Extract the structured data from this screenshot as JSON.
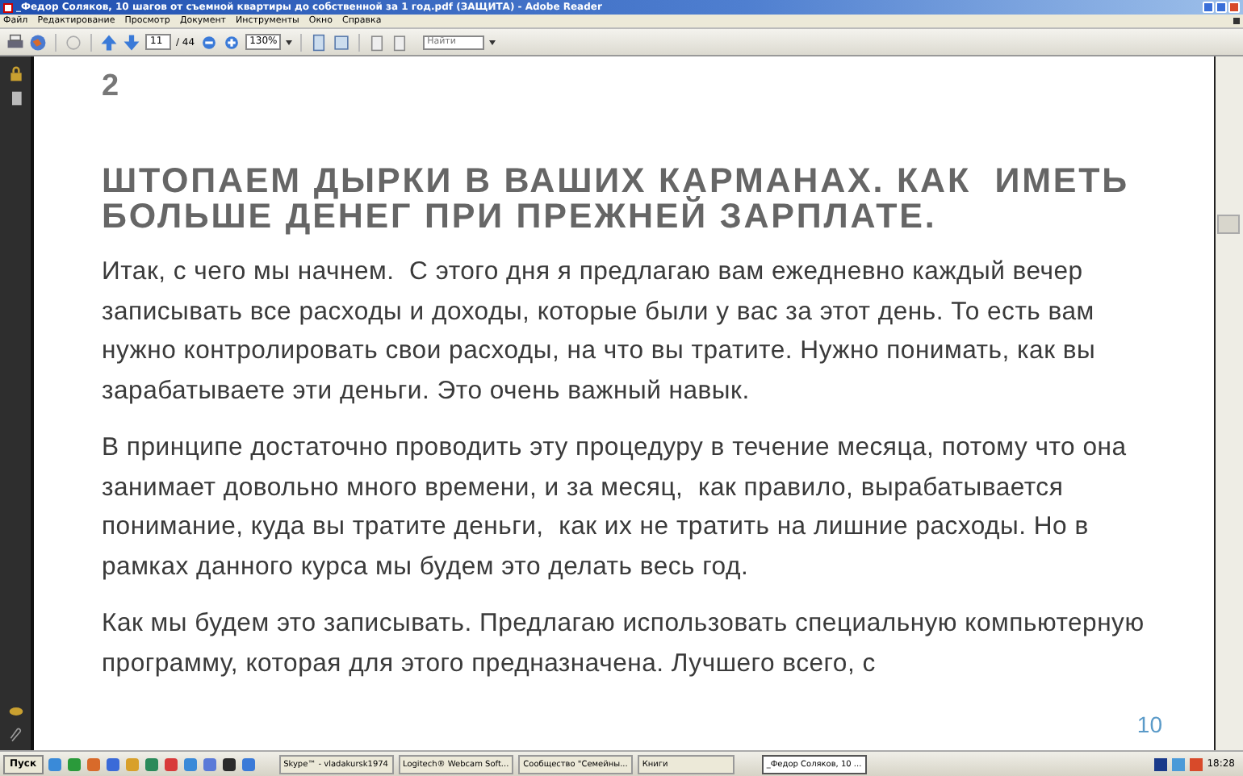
{
  "window": {
    "title": "_Федор Соляков, 10 шагов от съемной квартиры до  собственной за 1 год.pdf (ЗАЩИТА) - Adobe Reader"
  },
  "menu": [
    "Файл",
    "Редактирование",
    "Просмотр",
    "Документ",
    "Инструменты",
    "Окно",
    "Справка"
  ],
  "toolbar": {
    "page_number": "11",
    "page_total": "/ 44",
    "zoom": "130%",
    "search": {
      "placeholder": "Найти"
    }
  },
  "document": {
    "chapter_number": "2",
    "heading": "ШТОПАЕМ ДЫРКИ В ВАШИХ КАРМАНАХ. КАК  ИМЕТЬ БОЛЬШЕ ДЕНЕГ ПРИ ПРЕЖНЕЙ ЗАРПЛАТЕ.",
    "paragraphs": [
      "Итак, с чего мы начнем.  С этого дня я предлагаю вам ежедневно каждый вечер записывать все расходы и доходы, которые были у вас за этот день. То есть вам нужно контролировать свои расходы, на что вы тратите. Нужно понимать, как вы зарабатываете эти деньги. Это очень важный навык.",
      "В принципе достаточно проводить эту процедуру в течение месяца, потому что она занимает довольно много времени, и за месяц,  как правило, вырабатывается понимание, куда вы тратите деньги,  как их не тратить на лишние расходы. Но в рамках данного курса мы будем это делать весь год.",
      "Как мы будем это записывать. Предлагаю использовать специальную компьютерную программу, которая для этого предназначена. Лучшего всего, с"
    ],
    "page_number": "10"
  },
  "taskbar": {
    "start": "Пуск",
    "tasks": [
      {
        "label": "Skype™ - vladakursk1974",
        "selected": false
      },
      {
        "label": "Logitech® Webcam Soft...",
        "selected": false
      },
      {
        "label": "Сообщество \"Семейны...",
        "selected": false
      },
      {
        "label": "Книги",
        "selected": false
      },
      {
        "label": "_Федор Соляков, 10 ...",
        "selected": true
      }
    ],
    "clock": "18:28"
  }
}
